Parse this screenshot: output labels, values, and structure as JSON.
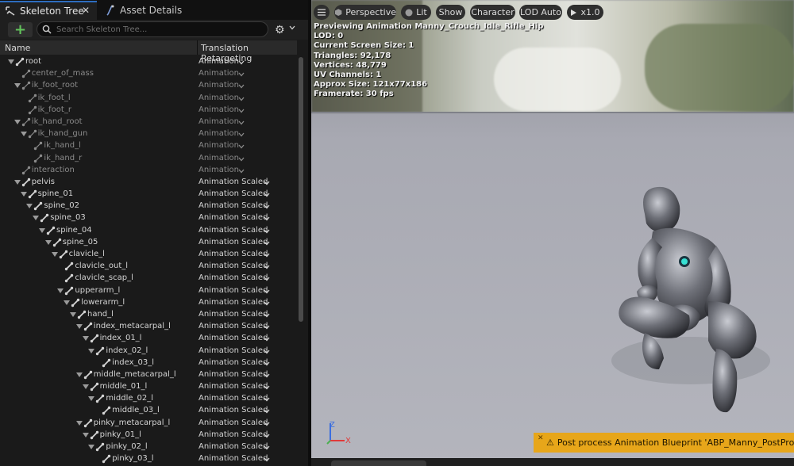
{
  "tabs": [
    {
      "label": "Skeleton Tree",
      "icon": "skeleton-icon",
      "active": true
    },
    {
      "label": "Asset Details",
      "icon": "asset-details-icon",
      "active": false
    }
  ],
  "toolbar": {
    "add_label": "+",
    "search_placeholder": "Search Skeleton Tree..."
  },
  "columns": {
    "name": "Name",
    "retargeting": "Translation Retargeting"
  },
  "tree": [
    {
      "name": "root",
      "depth": 0,
      "expander": true,
      "retargeting": "Animation",
      "dim": false
    },
    {
      "name": "center_of_mass",
      "depth": 1,
      "expander": false,
      "retargeting": "Animation",
      "dim": true
    },
    {
      "name": "ik_foot_root",
      "depth": 1,
      "expander": true,
      "retargeting": "Animation",
      "dim": true
    },
    {
      "name": "ik_foot_l",
      "depth": 2,
      "expander": false,
      "retargeting": "Animation",
      "dim": true
    },
    {
      "name": "ik_foot_r",
      "depth": 2,
      "expander": false,
      "retargeting": "Animation",
      "dim": true
    },
    {
      "name": "ik_hand_root",
      "depth": 1,
      "expander": true,
      "retargeting": "Animation",
      "dim": true
    },
    {
      "name": "ik_hand_gun",
      "depth": 2,
      "expander": true,
      "retargeting": "Animation",
      "dim": true
    },
    {
      "name": "ik_hand_l",
      "depth": 3,
      "expander": false,
      "retargeting": "Animation",
      "dim": true
    },
    {
      "name": "ik_hand_r",
      "depth": 3,
      "expander": false,
      "retargeting": "Animation",
      "dim": true
    },
    {
      "name": "interaction",
      "depth": 1,
      "expander": false,
      "retargeting": "Animation",
      "dim": true
    },
    {
      "name": "pelvis",
      "depth": 1,
      "expander": true,
      "retargeting": "Animation Scaled",
      "dim": false
    },
    {
      "name": "spine_01",
      "depth": 2,
      "expander": true,
      "retargeting": "Animation Scaled",
      "dim": false
    },
    {
      "name": "spine_02",
      "depth": 3,
      "expander": true,
      "retargeting": "Animation Scaled",
      "dim": false
    },
    {
      "name": "spine_03",
      "depth": 4,
      "expander": true,
      "retargeting": "Animation Scaled",
      "dim": false
    },
    {
      "name": "spine_04",
      "depth": 5,
      "expander": true,
      "retargeting": "Animation Scaled",
      "dim": false
    },
    {
      "name": "spine_05",
      "depth": 6,
      "expander": true,
      "retargeting": "Animation Scaled",
      "dim": false
    },
    {
      "name": "clavicle_l",
      "depth": 7,
      "expander": true,
      "retargeting": "Animation Scaled",
      "dim": false
    },
    {
      "name": "clavicle_out_l",
      "depth": 8,
      "expander": false,
      "retargeting": "Animation Scaled",
      "dim": false
    },
    {
      "name": "clavicle_scap_l",
      "depth": 8,
      "expander": false,
      "retargeting": "Animation Scaled",
      "dim": false
    },
    {
      "name": "upperarm_l",
      "depth": 8,
      "expander": true,
      "retargeting": "Animation Scaled",
      "dim": false
    },
    {
      "name": "lowerarm_l",
      "depth": 9,
      "expander": true,
      "retargeting": "Animation Scaled",
      "dim": false
    },
    {
      "name": "hand_l",
      "depth": 10,
      "expander": true,
      "retargeting": "Animation Scaled",
      "dim": false
    },
    {
      "name": "index_metacarpal_l",
      "depth": 11,
      "expander": true,
      "retargeting": "Animation Scaled",
      "dim": false
    },
    {
      "name": "index_01_l",
      "depth": 12,
      "expander": true,
      "retargeting": "Animation Scaled",
      "dim": false
    },
    {
      "name": "index_02_l",
      "depth": 13,
      "expander": true,
      "retargeting": "Animation Scaled",
      "dim": false
    },
    {
      "name": "index_03_l",
      "depth": 14,
      "expander": false,
      "retargeting": "Animation Scaled",
      "dim": false
    },
    {
      "name": "middle_metacarpal_l",
      "depth": 11,
      "expander": true,
      "retargeting": "Animation Scaled",
      "dim": false
    },
    {
      "name": "middle_01_l",
      "depth": 12,
      "expander": true,
      "retargeting": "Animation Scaled",
      "dim": false
    },
    {
      "name": "middle_02_l",
      "depth": 13,
      "expander": true,
      "retargeting": "Animation Scaled",
      "dim": false
    },
    {
      "name": "middle_03_l",
      "depth": 14,
      "expander": false,
      "retargeting": "Animation Scaled",
      "dim": false
    },
    {
      "name": "pinky_metacarpal_l",
      "depth": 11,
      "expander": true,
      "retargeting": "Animation Scaled",
      "dim": false
    },
    {
      "name": "pinky_01_l",
      "depth": 12,
      "expander": true,
      "retargeting": "Animation Scaled",
      "dim": false
    },
    {
      "name": "pinky_02_l",
      "depth": 13,
      "expander": true,
      "retargeting": "Animation Scaled",
      "dim": false
    },
    {
      "name": "pinky_03_l",
      "depth": 14,
      "expander": false,
      "retargeting": "Animation Scaled",
      "dim": false
    }
  ],
  "viewport": {
    "buttons": {
      "menu": "menu-icon",
      "perspective": "Perspective",
      "lit": "Lit",
      "show": "Show",
      "character": "Character",
      "lod": "LOD Auto",
      "speed": "x1.0"
    },
    "stats": [
      "Previewing Animation Manny_Crouch_Idle_Rifle_Hip",
      "LOD: 0",
      "Current Screen Size: 1",
      "Triangles: 92,178",
      "Vertices: 48,779",
      "UV Channels: 1",
      "Approx Size: 121x77x186",
      "Framerate: 30 fps"
    ],
    "gizmo": {
      "z": "Z",
      "x": "X"
    },
    "warning": "Post process Animation Blueprint 'ABP_Manny_PostProcess' is running"
  },
  "colors": {
    "accent": "#2d6dbf",
    "add": "#62c35b",
    "warning": "#e7a61a",
    "gizmo_x": "#e03a3a",
    "gizmo_z": "#3a6ee0"
  }
}
